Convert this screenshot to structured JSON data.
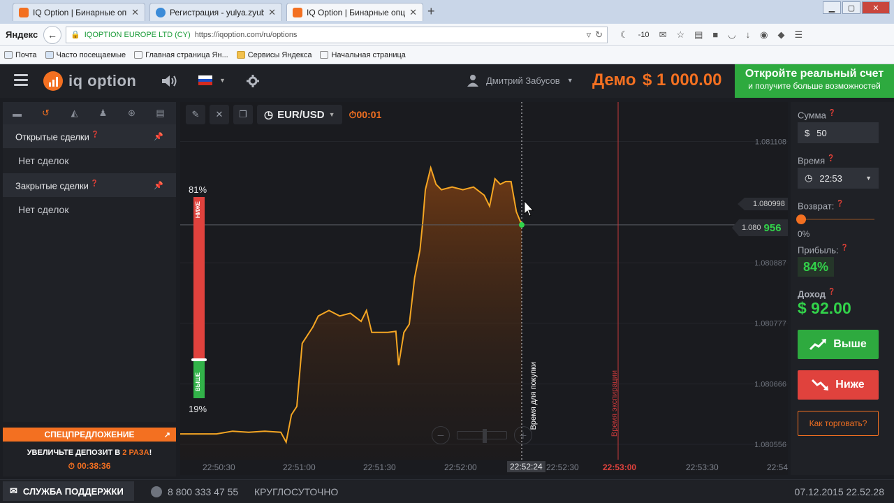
{
  "browser": {
    "tabs": [
      {
        "title": "IQ Option | Бинарные опц...",
        "active": false
      },
      {
        "title": "Регистрация - yulya.zyubi...",
        "active": false
      },
      {
        "title": "IQ Option | Бинарные опц...",
        "active": true
      }
    ],
    "new_tab": "+",
    "yandex_logo": "Яндекс",
    "cert_name": "IQOPTION EUROPE LTD (CY)",
    "url": "https://iqoption.com/ru/options",
    "weather": "-10",
    "bookmarks": [
      "Почта",
      "Часто посещаемые",
      "Главная страница Ян...",
      "Сервисы Яндекса",
      "Начальная страница"
    ]
  },
  "header": {
    "logo_text": "iq option",
    "user_name": "Дмитрий Забусов",
    "demo_label": "Демо",
    "balance": "$ 1 000.00",
    "open_account_title": "Откройте реальный счет",
    "open_account_sub": "и получите больше возможностей"
  },
  "left_panel": {
    "open_deals_title": "Открытые сделки",
    "open_deals_empty": "Нет сделок",
    "closed_deals_title": "Закрытые сделки",
    "closed_deals_empty": "Нет сделок"
  },
  "special_offer": {
    "title": "СПЕЦПРЕДЛОЖЕНИЕ",
    "text_before": "УВЕЛИЧЬТЕ ДЕПОЗИТ В ",
    "text_highlight": "2 РАЗА",
    "text_after": "!",
    "timer": "00:38:36"
  },
  "chart": {
    "asset": "EUR/USD",
    "timer": "00:01",
    "sentiment_top_pct": "81%",
    "sentiment_bottom_pct": "19%",
    "sentiment_down_label": "НИЖЕ",
    "sentiment_up_label": "ВЫШЕ",
    "sentiment_down_fraction": 0.81,
    "purchase_time_label": "Время для покупки",
    "expiration_time_label": "Время экспирации",
    "current_price_prefix": "1.080",
    "current_price_suffix": "956",
    "hover_price": "1.080998",
    "zoom_level_fraction": 0.5,
    "line_color": "#f5a623",
    "area_color": "#f37021"
  },
  "chart_data": {
    "type": "area",
    "y_ticks": [
      "1.081108",
      "1.080887",
      "1.080777",
      "1.080666",
      "1.080556"
    ],
    "x_ticks": [
      "22:50:30",
      "22:51:00",
      "22:51:30",
      "22:52:00",
      "22:52:24",
      "22:52:30",
      "22:53:00",
      "22:53:30",
      "22:54"
    ],
    "current_time": "22:52:24",
    "expiration_time": "22:53:00",
    "ylim": [
      1.0805,
      1.08118
    ],
    "points": [
      [
        "22:50:30",
        1.080575
      ],
      [
        "22:50:36",
        1.08058
      ],
      [
        "22:50:42",
        1.080578
      ],
      [
        "22:50:48",
        1.08058
      ],
      [
        "22:50:54",
        1.080578
      ],
      [
        "22:50:56",
        1.08056
      ],
      [
        "22:50:58",
        1.08061
      ],
      [
        "22:51:00",
        1.080625
      ],
      [
        "22:51:02",
        1.08074
      ],
      [
        "22:51:04",
        1.080755
      ],
      [
        "22:51:06",
        1.08077
      ],
      [
        "22:51:08",
        1.08079
      ],
      [
        "22:51:12",
        1.0808
      ],
      [
        "22:51:16",
        1.08079
      ],
      [
        "22:51:20",
        1.080795
      ],
      [
        "22:51:24",
        1.08078
      ],
      [
        "22:51:26",
        1.0808
      ],
      [
        "22:51:28",
        1.08076
      ],
      [
        "22:51:30",
        1.08076
      ],
      [
        "22:51:34",
        1.08076
      ],
      [
        "22:51:37",
        1.080762
      ],
      [
        "22:51:38",
        1.0807
      ],
      [
        "22:51:40",
        1.08076
      ],
      [
        "22:51:42",
        1.080775
      ],
      [
        "22:51:44",
        1.08086
      ],
      [
        "22:51:46",
        1.08091
      ],
      [
        "22:51:47",
        1.08096
      ],
      [
        "22:51:48",
        1.08102
      ],
      [
        "22:51:50",
        1.08106
      ],
      [
        "22:51:52",
        1.08103
      ],
      [
        "22:51:54",
        1.08102
      ],
      [
        "22:51:58",
        1.081025
      ],
      [
        "22:52:02",
        1.08102
      ],
      [
        "22:52:06",
        1.081025
      ],
      [
        "22:52:10",
        1.08101
      ],
      [
        "22:52:12",
        1.08099
      ],
      [
        "22:52:14",
        1.08104
      ],
      [
        "22:52:16",
        1.08103
      ],
      [
        "22:52:18",
        1.081035
      ],
      [
        "22:52:20",
        1.081035
      ],
      [
        "22:52:22",
        1.08098
      ],
      [
        "22:52:24",
        1.080956
      ]
    ]
  },
  "right_panel": {
    "amount_label": "Сумма",
    "amount_currency": "$",
    "amount_value": "50",
    "time_label": "Время",
    "time_value": "22:53",
    "return_label": "Возврат:",
    "return_value": "0%",
    "return_fraction": 0,
    "profit_label": "Прибыль:",
    "profit_value": "84%",
    "income_label": "Доход",
    "income_value": "$ 92.00",
    "up_button": "Выше",
    "down_button": "Ниже",
    "how_to_trade": "Как торговать?"
  },
  "footer": {
    "support_label": "СЛУЖБА ПОДДЕРЖКИ",
    "phone": "8 800 333 47 55",
    "hours": "КРУГЛОСУТОЧНО",
    "datetime": "07.12.2015 22.52.28"
  }
}
